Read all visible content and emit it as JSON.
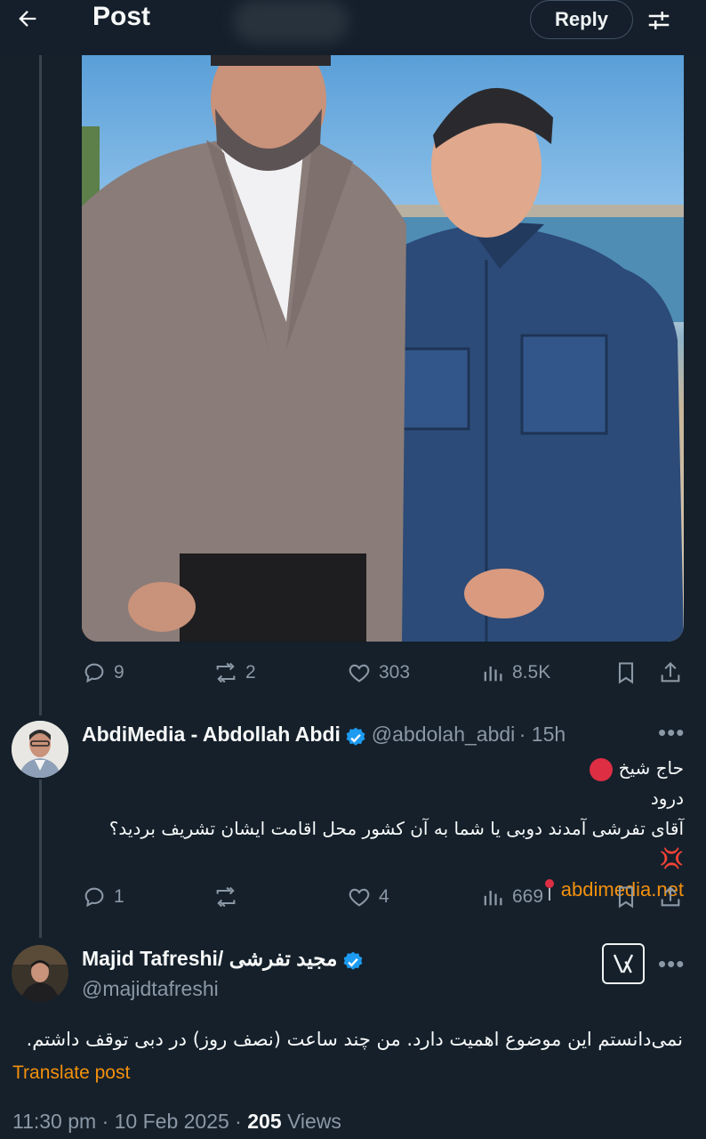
{
  "header": {
    "title": "Post",
    "reply_label": "Reply"
  },
  "original_post": {
    "stats": {
      "replies": "9",
      "reposts": "2",
      "likes": "303",
      "views": "8.5K"
    }
  },
  "reply1": {
    "display_name": "AbdiMedia - Abdollah Abdi",
    "handle": "@abdolah_abdi",
    "time": "· 15h",
    "line1": "حاج شیخ",
    "line2": "درود",
    "line3": "آقای تفرشی آمدند دوبی یا شما به آن کشور محل اقامت ایشان تشریف بردید؟",
    "link": "abdimedia.net",
    "stats": {
      "replies": "1",
      "reposts": "",
      "likes": "4",
      "views": "669"
    }
  },
  "reply2": {
    "display_name": "Majid Tafreshi/ مجید تفرشی",
    "handle": "@majidtafreshi",
    "text": "نمی‌دانستم این موضوع اهمیت دارد. من چند ساعت (نصف روز) در دبی توقف داشتم.",
    "translate_label": "Translate post",
    "time": "11:30 pm · 10 Feb 2025 · ",
    "views_count": "205",
    "views_label": " Views"
  },
  "colors": {
    "background": "#15202b",
    "muted": "#8b98a5",
    "verified": "#1d9bf0",
    "link": "#f4900c"
  }
}
